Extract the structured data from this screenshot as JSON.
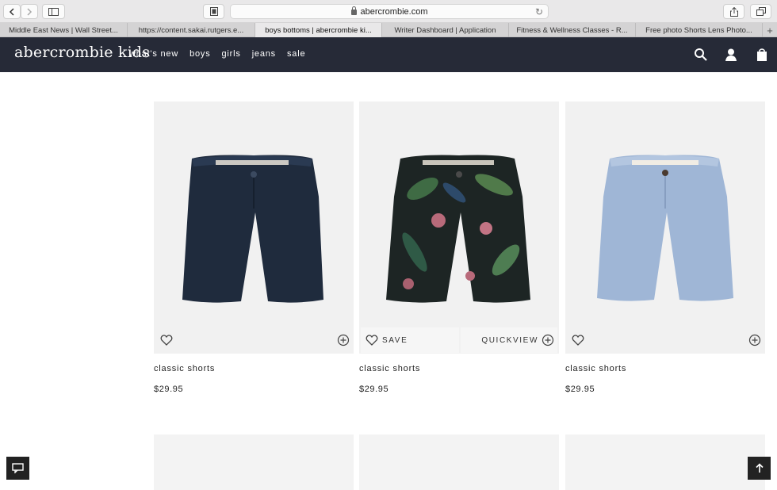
{
  "browser": {
    "url": "abercrombie.com",
    "tabs": [
      {
        "label": "Middle East News | Wall Street..."
      },
      {
        "label": "https://content.sakai.rutgers.e..."
      },
      {
        "label": "boys bottoms | abercrombie ki..."
      },
      {
        "label": "Writer Dashboard | Application"
      },
      {
        "label": "Fitness & Wellness Classes - R..."
      },
      {
        "label": "Free photo Shorts Lens Photo..."
      }
    ],
    "active_tab_index": 2
  },
  "site": {
    "logo": "abercrombie kids",
    "nav": [
      "what's new",
      "boys",
      "girls",
      "jeans",
      "sale"
    ]
  },
  "products": [
    {
      "name": "classic shorts",
      "price": "$29.95",
      "color": "navy"
    },
    {
      "name": "classic shorts",
      "price": "$29.95",
      "color": "floral print"
    },
    {
      "name": "classic shorts",
      "price": "$29.95",
      "color": "light blue"
    }
  ],
  "hover_bar": {
    "save_label": "SAVE",
    "quickview_label": "QUICKVIEW"
  },
  "colors": {
    "header_bg": "#262a37",
    "navy_short": "#1f2b3d",
    "blue_short": "#9fb6d6",
    "floral_bg": "#1d2524"
  }
}
